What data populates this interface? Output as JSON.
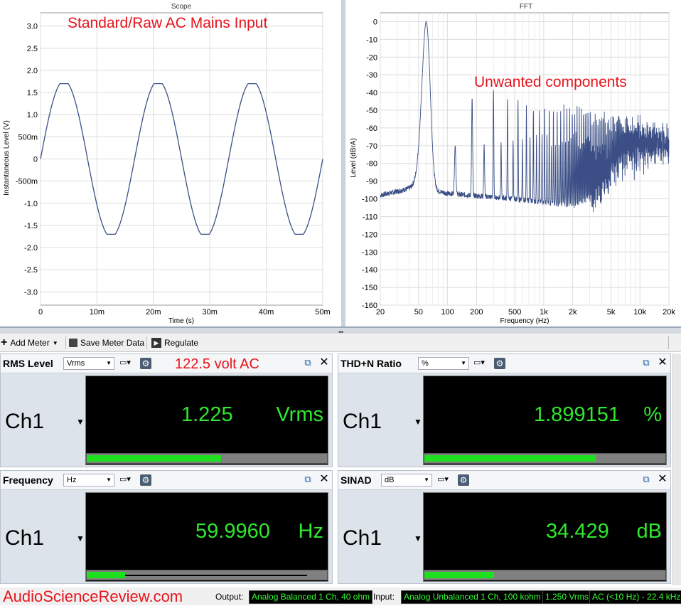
{
  "scope": {
    "title": "Scope",
    "annotation": "Standard/Raw AC Mains Input",
    "ylabel": "Instantaneous Level (V)",
    "xlabel": "Time (s)",
    "yticks": [
      "3.0",
      "2.5",
      "2.0",
      "1.5",
      "1.0",
      "500m",
      "0",
      "-500m",
      "-1.0",
      "-1.5",
      "-2.0",
      "-2.5",
      "-3.0"
    ],
    "xticks": [
      "0",
      "10m",
      "20m",
      "30m",
      "40m",
      "50m"
    ]
  },
  "fft": {
    "title": "FFT",
    "annotation": "Unwanted components",
    "ylabel": "Level (dBrA)",
    "xlabel": "Frequency (Hz)",
    "yticks": [
      "0",
      "-10",
      "-20",
      "-30",
      "-40",
      "-50",
      "-60",
      "-70",
      "-80",
      "-90",
      "-100",
      "-110",
      "-120",
      "-130",
      "-140",
      "-150",
      "-160"
    ],
    "xticks": [
      "20",
      "50",
      "100",
      "200",
      "500",
      "1k",
      "2k",
      "5k",
      "10k",
      "20k"
    ]
  },
  "chart_data": [
    {
      "type": "line",
      "title": "Scope",
      "xlabel": "Time (s)",
      "ylabel": "Instantaneous Level (V)",
      "xlim": [
        0,
        0.05
      ],
      "ylim": [
        -3.3,
        3.3
      ],
      "grid": true,
      "series": [
        {
          "frequency_hz": 59.996,
          "amplitude_v": 1.7,
          "start_v": 0
        }
      ]
    },
    {
      "type": "line",
      "title": "FFT",
      "xlabel": "Frequency (Hz)",
      "ylabel": "Level (dBrA)",
      "xscale": "log",
      "xlim": [
        20,
        20000
      ],
      "ylim": [
        -160,
        5
      ],
      "grid": true,
      "peaks": [
        {
          "x": 60,
          "y": 0
        },
        {
          "x": 180,
          "y": -43
        },
        {
          "x": 300,
          "y": -38
        },
        {
          "x": 420,
          "y": -43
        },
        {
          "x": 540,
          "y": -44
        },
        {
          "x": 660,
          "y": -47
        }
      ],
      "noise_floor": [
        {
          "x": 20,
          "y": -98
        },
        {
          "x": 50,
          "y": -93
        },
        {
          "x": 100,
          "y": -97
        },
        {
          "x": 500,
          "y": -100
        },
        {
          "x": 2000,
          "y": -104
        },
        {
          "x": 10000,
          "y": -110
        },
        {
          "x": 20000,
          "y": -120
        }
      ]
    }
  ],
  "toolbar": {
    "add_meter": "Add Meter",
    "save_meter_data": "Save Meter Data",
    "regulate": "Regulate"
  },
  "meters": {
    "rms": {
      "name": "RMS Level",
      "unit_select": "Vrms",
      "channel": "Ch1",
      "value": "1.225",
      "unit": "Vrms",
      "annotation": "122.5 volt AC",
      "bar_level": 0.56
    },
    "thd": {
      "name": "THD+N Ratio",
      "unit_select": "%",
      "channel": "Ch1",
      "value": "1.899151",
      "unit": "%",
      "bar_level": 0.71
    },
    "freq": {
      "name": "Frequency",
      "unit_select": "Hz",
      "channel": "Ch1",
      "value": "59.9960",
      "unit": "Hz",
      "bar_level": 0.16
    },
    "sinad": {
      "name": "SINAD",
      "unit_select": "dB",
      "channel": "Ch1",
      "value": "34.429",
      "unit": "dB",
      "bar_level": 0.29
    }
  },
  "status": {
    "watermark": "AudioScienceReview.com",
    "output_label": "Output:",
    "output_value": "Analog Balanced 1 Ch, 40 ohm",
    "input_label": "Input:",
    "input_value": "Analog Unbalanced 1 Ch, 100 kohm",
    "input_level": "1.250 Vrms",
    "bandwidth": "AC (<10 Hz) - 22.4 kHz"
  },
  "colors": {
    "trace": "#3b4f86",
    "reading": "#2fe82f",
    "annotation": "#e8141c",
    "bar": "#1fe01f"
  }
}
